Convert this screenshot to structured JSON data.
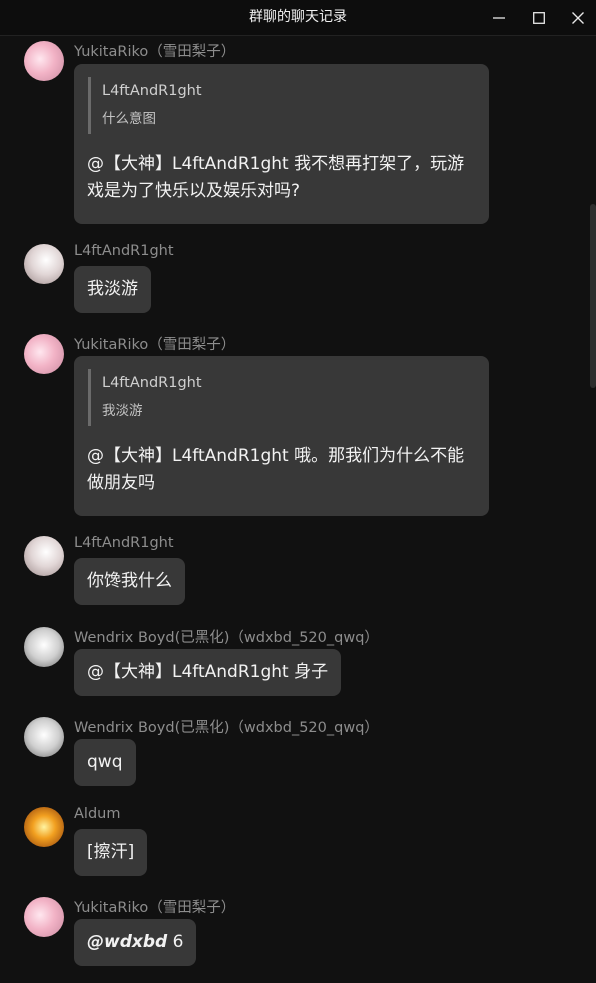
{
  "window": {
    "title": "群聊的聊天记录"
  },
  "messages": [
    {
      "sender": "YukitaRiko（雪田梨子）",
      "quote": {
        "author": "L4ftAndR1ght",
        "text": "什么意图"
      },
      "text": "@【大神】L4ftAndR1ght 我不想再打架了，玩游戏是为了快乐以及娱乐对吗?"
    },
    {
      "sender": "L4ftAndR1ght",
      "text": "我淡游"
    },
    {
      "sender": "YukitaRiko（雪田梨子）",
      "quote": {
        "author": "L4ftAndR1ght",
        "text": "我淡游"
      },
      "text": "@【大神】L4ftAndR1ght 哦。那我们为什么不能做朋友吗"
    },
    {
      "sender": "L4ftAndR1ght",
      "text": "你馋我什么"
    },
    {
      "sender": "Wendrix Boyd(已黑化)（wdxbd_520_qwq）",
      "text": "@【大神】L4ftAndR1ght 身子"
    },
    {
      "sender": "Wendrix Boyd(已黑化)（wdxbd_520_qwq）",
      "text": "qwq"
    },
    {
      "sender": "Aldum",
      "text": "[擦汗]"
    },
    {
      "sender": "YukitaRiko（雪田梨子）",
      "mention": "@wdxbd",
      "text": " 6"
    }
  ],
  "icons": {
    "minimize": "minimize-icon",
    "maximize": "maximize-icon",
    "close": "close-icon"
  },
  "colors": {
    "background": "#111111",
    "bubble": "#383838",
    "sender": "#8d8d8d"
  }
}
